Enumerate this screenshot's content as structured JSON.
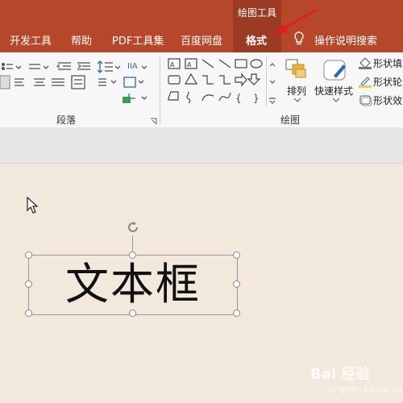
{
  "ribbon_tabs": {
    "context_group": "绘图工具",
    "tabs": [
      "开发工具",
      "帮助",
      "PDF工具集",
      "百度网盘",
      "格式"
    ],
    "active": "格式",
    "tell_me": "操作说明搜索"
  },
  "ribbon": {
    "groups": {
      "paragraph": "段落",
      "drawing": "绘图"
    },
    "buttons": {
      "arrange": "排列",
      "quick_styles": "快速样式",
      "shape_fill": "形状填",
      "shape_outline": "形状轮",
      "shape_effects": "形状效"
    }
  },
  "slide": {
    "textbox_text": "文本框"
  },
  "watermark": {
    "brand": "Bai 经验",
    "url": "jingyan.baidu.com"
  },
  "colors": {
    "accent": "#b7472a",
    "context": "#9c3b23",
    "arrow": "#e02020"
  }
}
